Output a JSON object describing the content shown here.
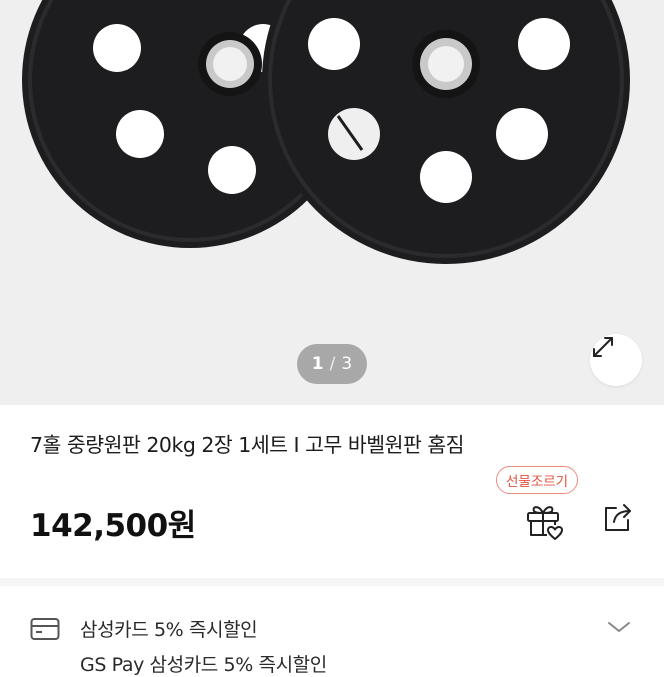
{
  "product_image": {
    "counter_current": "1",
    "counter_separator": "/",
    "counter_total": "3"
  },
  "product": {
    "title": "7홀 중량원판 20kg 2장 1세트 I 고무 바벨원판 홈짐",
    "price": "142,500원",
    "gift_badge": "선물조르기"
  },
  "benefits": [
    {
      "text": "삼성카드 5% 즉시할인"
    },
    {
      "text": "GS Pay 삼성카드 5% 즉시할인"
    }
  ],
  "colors": {
    "hero_bg": "#efefef",
    "accent_red": "#e5533f",
    "plate_black": "#1d1d1f"
  }
}
